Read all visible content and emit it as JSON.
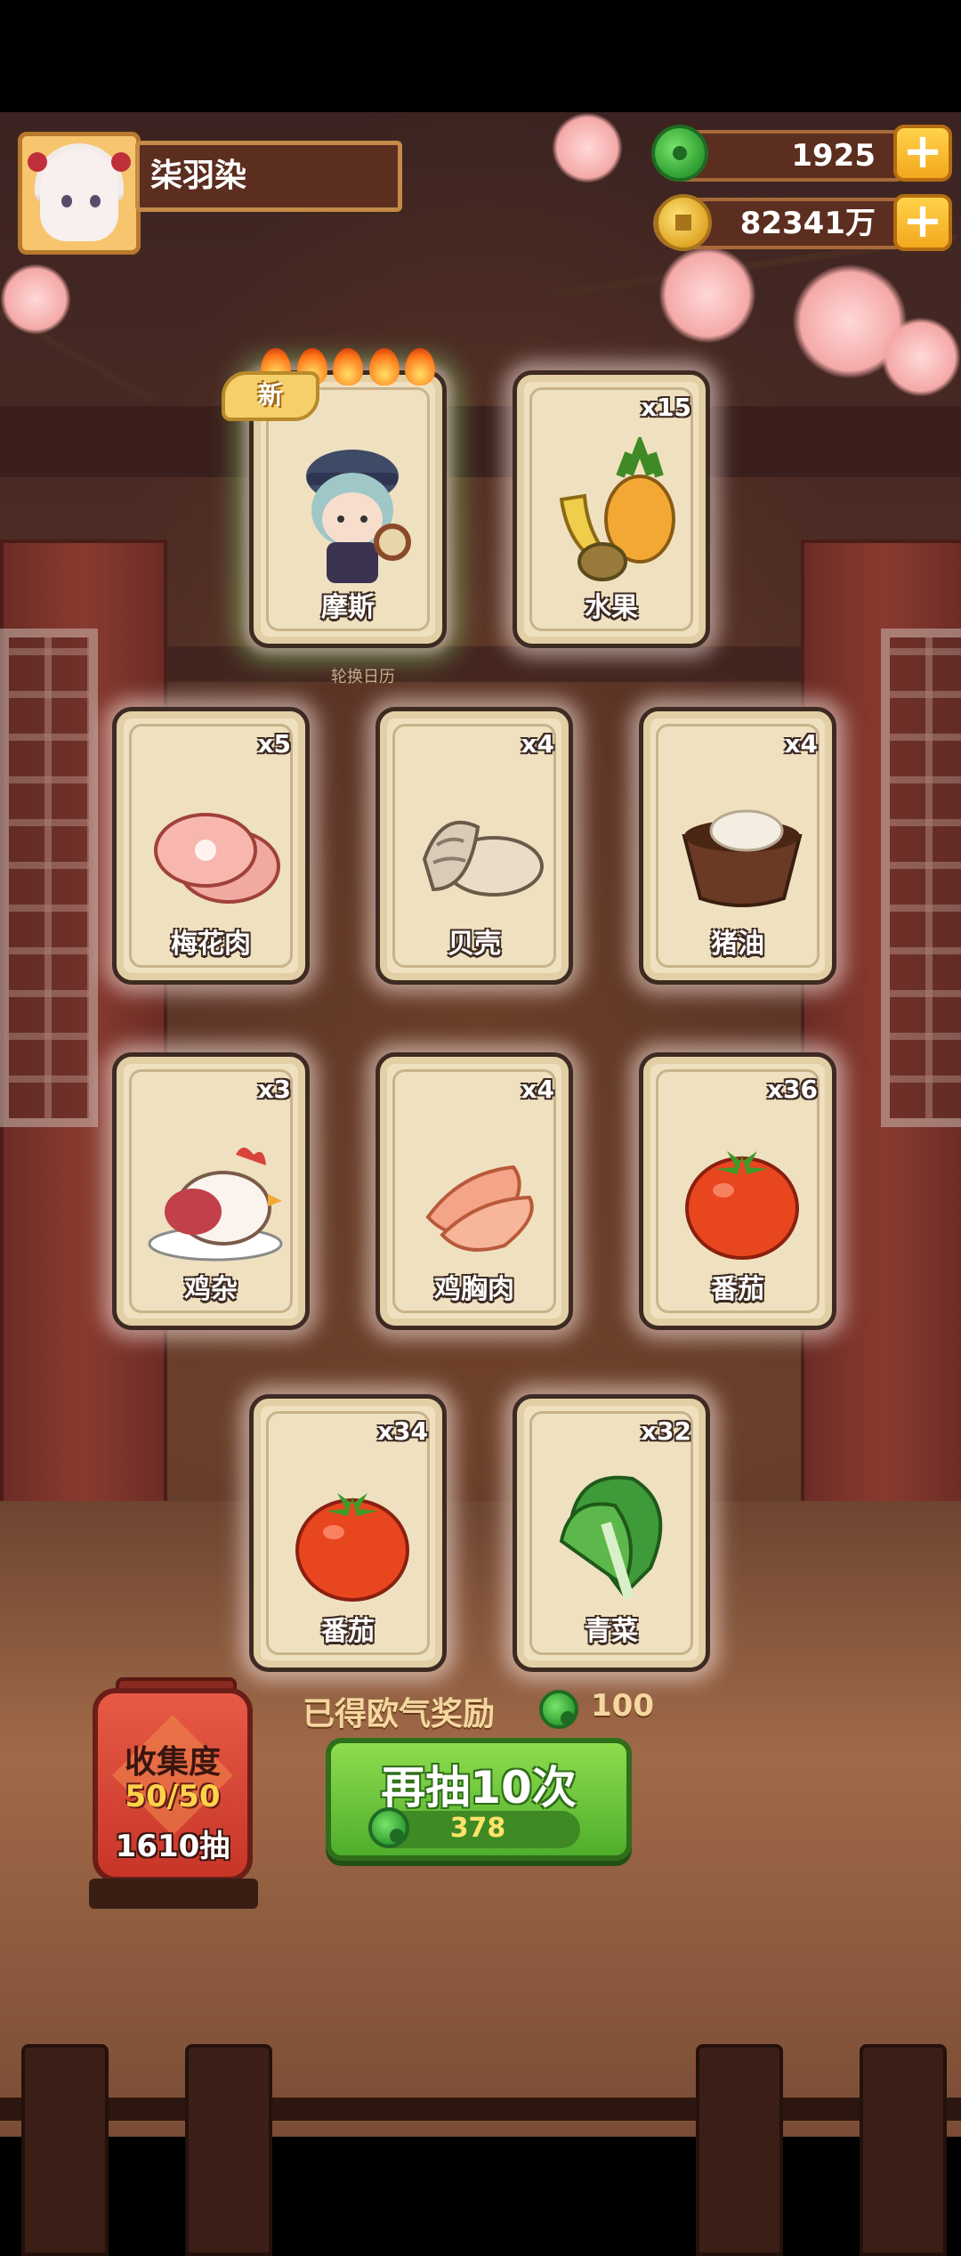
{
  "player": {
    "name": "柒羽染"
  },
  "resources": {
    "jade": {
      "value": "1925",
      "icon": "jade-coin-icon"
    },
    "gold": {
      "value": "82341万",
      "icon": "gold-coin-icon"
    }
  },
  "cards": [
    {
      "label": "摩斯",
      "count": "",
      "badge": "新",
      "rarity_flames": 5
    },
    {
      "label": "水果",
      "count": "x15"
    },
    {
      "label": "梅花肉",
      "count": "x5"
    },
    {
      "label": "贝壳",
      "count": "x4"
    },
    {
      "label": "猪油",
      "count": "x4"
    },
    {
      "label": "鸡杂",
      "count": "x3"
    },
    {
      "label": "鸡胸肉",
      "count": "x4"
    },
    {
      "label": "番茄",
      "count": "x36"
    },
    {
      "label": "番茄",
      "count": "x34"
    },
    {
      "label": "青菜",
      "count": "x32"
    }
  ],
  "background_sign": "轮换日历",
  "reward": {
    "label": "已得欧气奖励",
    "value": "100"
  },
  "draw_button": {
    "label": "再抽10次",
    "cost": "378"
  },
  "collection": {
    "title": "收集度",
    "progress": "50/50",
    "draws": "1610抽"
  },
  "colors": {
    "primary_green": "#4fae2c",
    "gold": "#f3a81e",
    "card_bg": "#efe1c0"
  }
}
